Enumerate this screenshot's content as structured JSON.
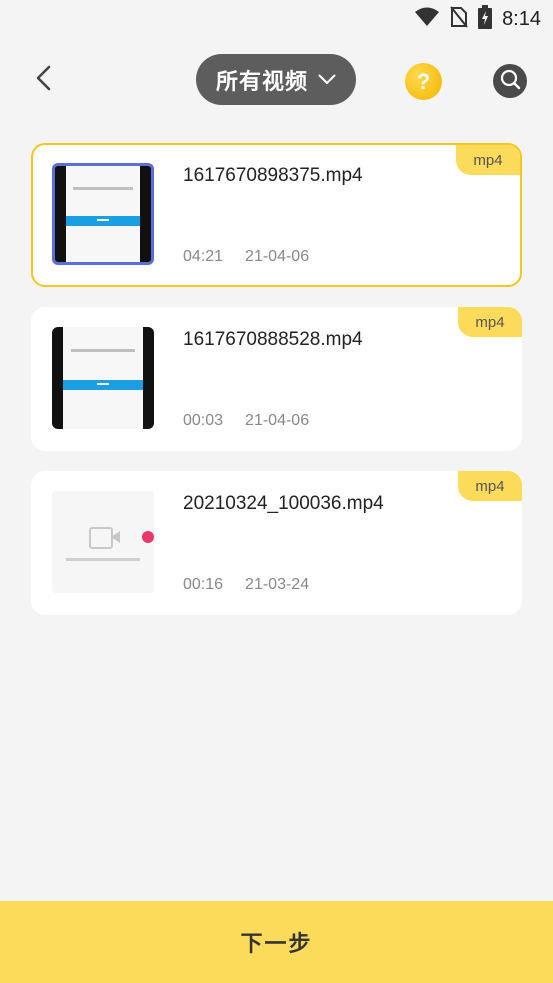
{
  "status_bar": {
    "time": "8:14",
    "icons": [
      "wifi-icon",
      "no-sim-icon",
      "battery-charging-icon"
    ]
  },
  "header": {
    "title": "所有视频",
    "back_icon": "chevron-left-icon",
    "dropdown_icon": "chevron-down-icon",
    "help_label": "?",
    "search_icon": "search-icon"
  },
  "videos": [
    {
      "filename": "1617670898375.mp4",
      "duration": "04:21",
      "date": "21-04-06",
      "ext": "mp4",
      "selected": true,
      "thumb": "screen-recording"
    },
    {
      "filename": "1617670888528.mp4",
      "duration": "00:03",
      "date": "21-04-06",
      "ext": "mp4",
      "selected": false,
      "thumb": "screen-recording"
    },
    {
      "filename": "20210324_100036.mp4",
      "duration": "00:16",
      "date": "21-03-24",
      "ext": "mp4",
      "selected": false,
      "thumb": "placeholder-video-icon"
    }
  ],
  "footer": {
    "next_label": "下一步"
  },
  "colors": {
    "accent": "#fddb5a",
    "selected_border": "#f5c722",
    "title_pill": "#5d5d5d"
  }
}
